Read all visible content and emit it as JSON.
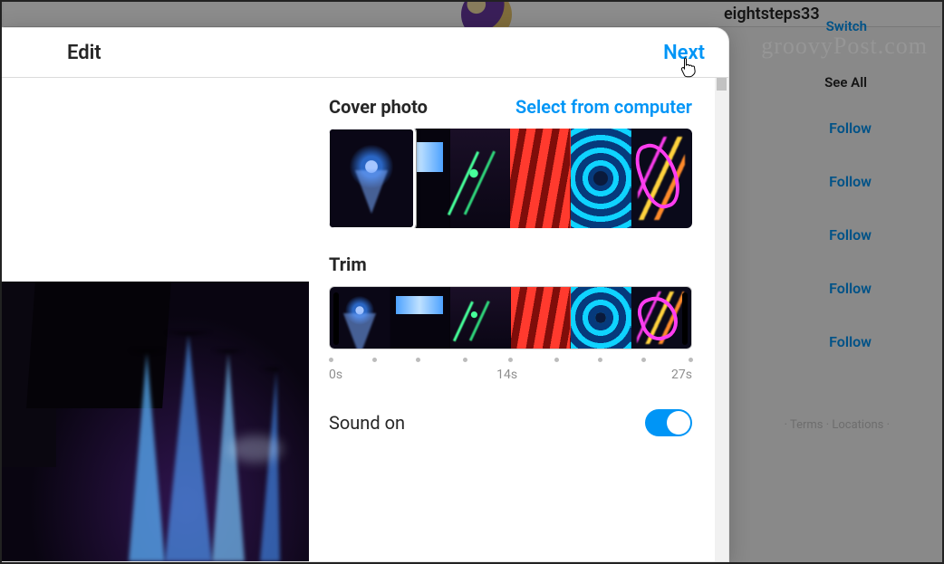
{
  "header": {
    "title": "Edit",
    "next_label": "Next"
  },
  "cover": {
    "title": "Cover photo",
    "select_label": "Select from computer"
  },
  "trim": {
    "title": "Trim",
    "ticks": [
      "0s",
      "14s",
      "27s"
    ]
  },
  "sound": {
    "label": "Sound on",
    "on": true
  },
  "background": {
    "username": "eightsteps33",
    "switch_label": "Switch",
    "see_all_label": "See All",
    "follow_label": "Follow",
    "follow_count": 5,
    "footer": "· Terms · Locations ·"
  },
  "watermark": "groovyPost.com"
}
